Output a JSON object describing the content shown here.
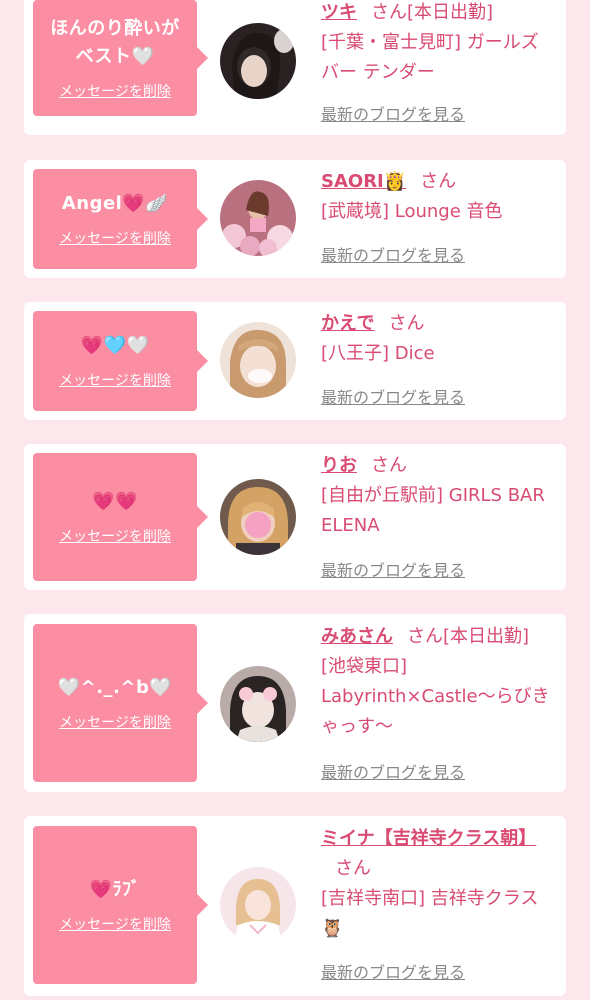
{
  "cards": [
    {
      "message": "ほんのり酔いがベスト🤍",
      "delete_label": "メッセージを削除",
      "name": "ツキ",
      "honorific": "さん",
      "status": "[本日出勤]",
      "shop": "[千葉・富士見町] ガールズバー テンダー",
      "blog_label": "最新のブログを見る",
      "avatar_palette": [
        "#3a2f2f",
        "#d9c2b6",
        "#1b1515"
      ]
    },
    {
      "message": "Angel💗🪽",
      "delete_label": "メッセージを削除",
      "name": "SAORI👸",
      "honorific": "さん",
      "status": "",
      "shop": "[武蔵境] Lounge 音色",
      "blog_label": "最新のブログを見る",
      "avatar_palette": [
        "#c98aa0",
        "#f3d2de",
        "#6e3a45"
      ]
    },
    {
      "message": "💗🩵🤍",
      "delete_label": "メッセージを削除",
      "name": "かえで",
      "honorific": "さん",
      "status": "",
      "shop": "[八王子] Dice",
      "blog_label": "最新のブログを見る",
      "avatar_palette": [
        "#e7c9b6",
        "#f6ebe3",
        "#b07f5b"
      ]
    },
    {
      "message": "💗💗",
      "delete_label": "メッセージを削除",
      "name": "りお",
      "honorific": "さん",
      "status": "",
      "shop": "[自由が丘駅前] GIRLS BAR ELENA",
      "blog_label": "最新のブログを見る",
      "avatar_palette": [
        "#d8a46a",
        "#f4a6c4",
        "#7a5a45"
      ]
    },
    {
      "message": "🤍^._.^b🤍",
      "delete_label": "メッセージを削除",
      "name": "みあさん",
      "honorific": "さん",
      "status": "[本日出勤]",
      "shop": "[池袋東口] Labyrinth×Castle〜らびきゃっす〜",
      "blog_label": "最新のブログを見る",
      "avatar_palette": [
        "#c8b9b4",
        "#f2e6e2",
        "#2b2626"
      ]
    },
    {
      "message": "💗ﾗﾌﾞ",
      "delete_label": "メッセージを削除",
      "name": "ミイナ【吉祥寺クラス朝】",
      "honorific": "さん",
      "status": "",
      "shop": "[吉祥寺南口] 吉祥寺クラス🦉",
      "blog_label": "最新のブログを見る",
      "avatar_palette": [
        "#f1d7dd",
        "#ffffff",
        "#e2b38c"
      ]
    }
  ]
}
